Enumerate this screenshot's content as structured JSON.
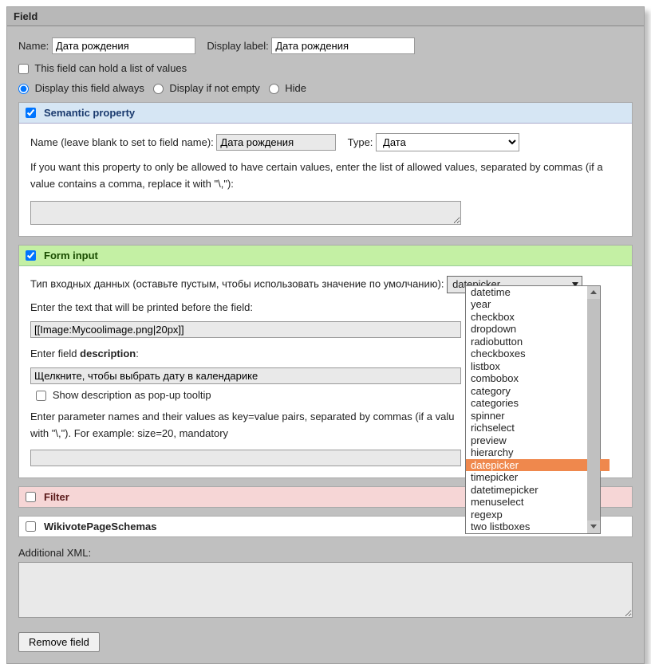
{
  "panel": {
    "title": "Field"
  },
  "field": {
    "name_label": "Name:",
    "name_value": "Дата рождения",
    "display_label_label": "Display label:",
    "display_label_value": "Дата рождения",
    "list_values_label": "This field can hold a list of values",
    "list_values_checked": false,
    "display_mode": {
      "always": "Display this field always",
      "if_not_empty": "Display if not empty",
      "hide": "Hide",
      "selected": "always"
    }
  },
  "semantic": {
    "title": "Semantic property",
    "checked": true,
    "name_label": "Name (leave blank to set to field name):",
    "name_value": "Дата рождения",
    "type_label": "Type:",
    "type_value": "Дата",
    "allowed_help": "If you want this property to only be allowed to have certain values, enter the list of allowed values, separated by commas (if a value contains a comma, replace it with \"\\,\"):",
    "allowed_value": ""
  },
  "forminput": {
    "title": "Form input",
    "checked": true,
    "type_label": "Тип входных данных (оставьте пустым, чтобы использовать значение по умолчанию):",
    "type_value": "datepicker",
    "before_label": "Enter the text that will be printed before the field:",
    "before_value": "[[Image:Mycoolimage.png|20px]]",
    "desc_label_prefix": "Enter field ",
    "desc_label_bold": "description",
    "desc_value": "Щелкните, чтобы выбрать дату в календарике",
    "tooltip_label": "Show description as pop-up tooltip",
    "tooltip_checked": false,
    "params_help_prefix": "Enter parameter names and their values as key=value pairs, separated by commas (if a valu",
    "params_help_suffix": "with \"\\,\"). For example: size=20, mandatory",
    "params_value": "",
    "options": [
      "datetime",
      "year",
      "checkbox",
      "dropdown",
      "radiobutton",
      "checkboxes",
      "listbox",
      "combobox",
      "category",
      "categories",
      "spinner",
      "richselect",
      "preview",
      "hierarchy",
      "datepicker",
      "timepicker",
      "datetimepicker",
      "menuselect",
      "regexp",
      "two listboxes"
    ],
    "selected_option_index": 14
  },
  "filter": {
    "title": "Filter",
    "checked": false
  },
  "wikivote": {
    "title": "WikivotePageSchemas",
    "checked": false
  },
  "additional": {
    "label": "Additional XML:",
    "value": ""
  },
  "buttons": {
    "remove": "Remove field"
  }
}
